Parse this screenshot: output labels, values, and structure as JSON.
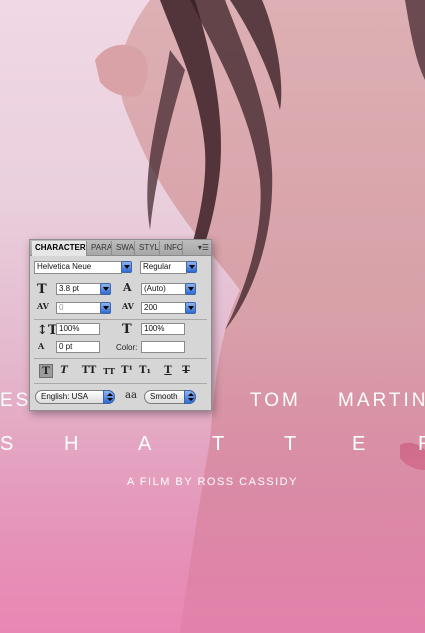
{
  "poster": {
    "credit_left": "ES",
    "credit_mid": "TOM",
    "credit_right": "MARTIN",
    "title_letters": [
      "S",
      "H",
      "A",
      "T",
      "T",
      "E",
      "R"
    ],
    "byline": "A FILM BY ROSS CASSIDY"
  },
  "panel": {
    "tabs": [
      "CHARACTER",
      "PARA",
      "SWA",
      "STYL",
      "INFO"
    ],
    "font_family": "Helvetica Neue",
    "font_style": "Regular",
    "font_size": "3.8 pt",
    "leading": "(Auto)",
    "kerning": "0",
    "tracking": "200",
    "vertical_scale": "100%",
    "horizontal_scale": "100%",
    "baseline_shift": "0 pt",
    "color_label": "Color:",
    "language": "English: USA",
    "aa_icon": "aa",
    "antialias": "Smooth",
    "style_buttons": [
      "T",
      "T",
      "TT",
      "TT",
      "T¹",
      "T₁",
      "T",
      "T"
    ]
  }
}
